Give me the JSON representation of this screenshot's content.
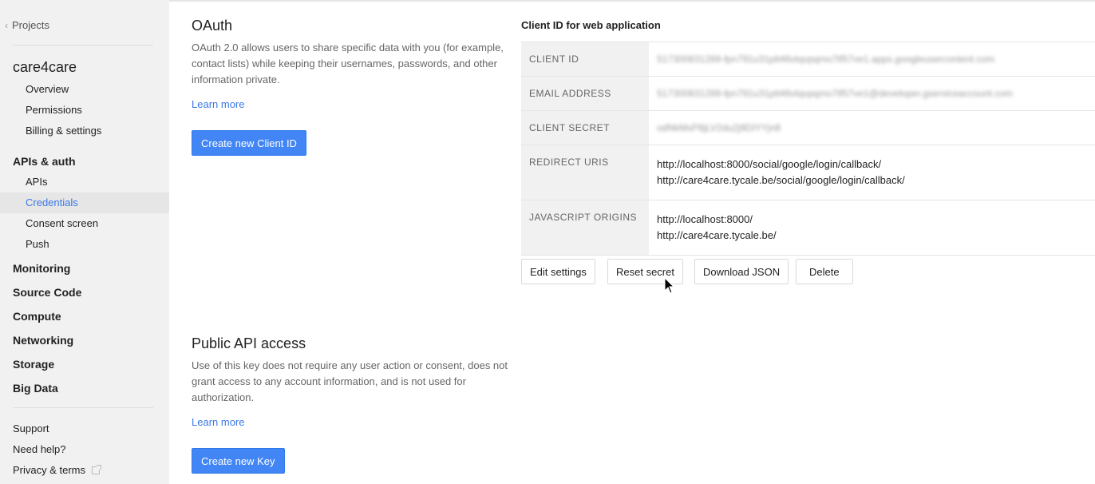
{
  "sidebar": {
    "back_label": "Projects",
    "project_name": "care4care",
    "project_items": [
      "Overview",
      "Permissions",
      "Billing & settings"
    ],
    "apis_section": "APIs & auth",
    "apis_items": [
      "APIs",
      "Credentials",
      "Consent screen",
      "Push"
    ],
    "active_item": "Credentials",
    "sections": [
      "Monitoring",
      "Source Code",
      "Compute",
      "Networking",
      "Storage",
      "Big Data"
    ],
    "footer": [
      "Support",
      "Need help?",
      "Privacy & terms"
    ]
  },
  "oauth": {
    "title": "OAuth",
    "description": "OAuth 2.0 allows users to share specific data with you (for example, contact lists) while keeping their usernames, passwords, and other information private.",
    "learn_more": "Learn more",
    "create_button": "Create new Client ID"
  },
  "public_api": {
    "title": "Public API access",
    "description": "Use of this key does not require any user action or consent, does not grant access to any account information, and is not used for authorization.",
    "learn_more": "Learn more",
    "create_button": "Create new Key"
  },
  "client_panel": {
    "title": "Client ID for web application",
    "rows": [
      {
        "key": "CLIENT ID",
        "values": [
          "517300831289-fpn791u31ptt46vtqvpqmo7tf57ve1.apps.googleusercontent.com"
        ],
        "blurred": true
      },
      {
        "key": "EMAIL ADDRESS",
        "values": [
          "517300831289-fpn791u31ptt46vtqvpqmo7tf57ve1@developer.gserviceaccount.com"
        ],
        "blurred": true
      },
      {
        "key": "CLIENT SECRET",
        "values": [
          "odNkMxP8jLV2du2j9DIYYjn8"
        ],
        "blurred": true
      },
      {
        "key": "REDIRECT URIS",
        "values": [
          "http://localhost:8000/social/google/login/callback/",
          "http://care4care.tycale.be/social/google/login/callback/"
        ],
        "blurred": false
      },
      {
        "key": "JAVASCRIPT ORIGINS",
        "values": [
          "http://localhost:8000/",
          "http://care4care.tycale.be/"
        ],
        "blurred": false
      }
    ],
    "buttons": {
      "edit": "Edit settings",
      "reset": "Reset secret",
      "download": "Download JSON",
      "delete": "Delete"
    }
  }
}
